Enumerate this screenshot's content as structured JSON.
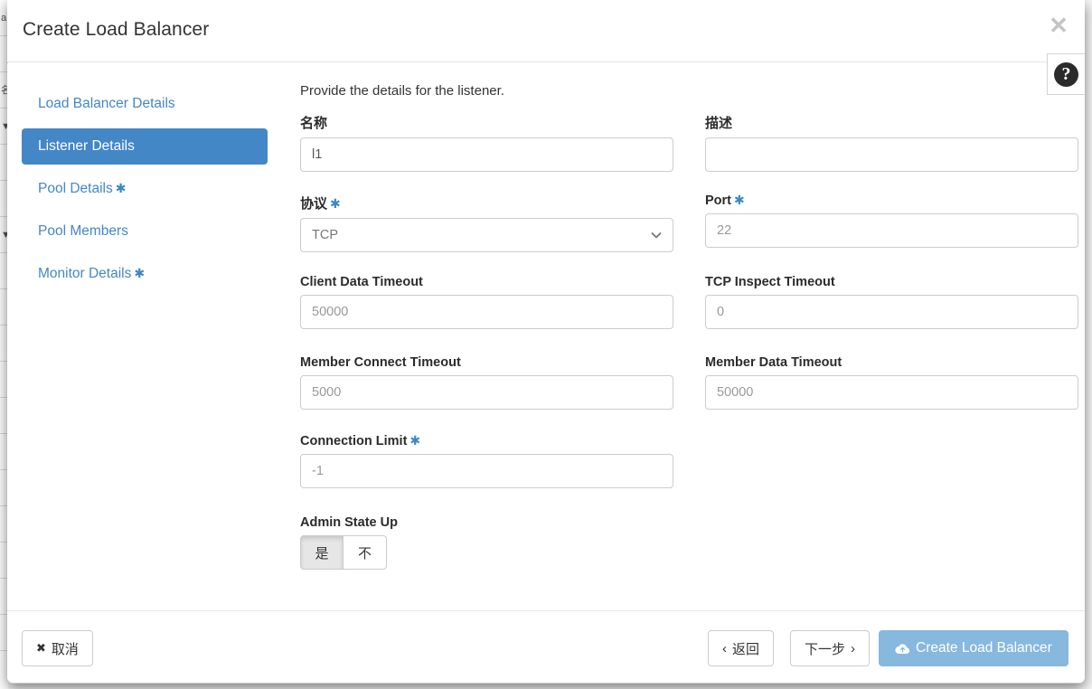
{
  "modal": {
    "title": "Create Load Balancer",
    "close_icon": "close-icon",
    "help_icon": "help-circle-icon",
    "help_glyph": "?"
  },
  "wizard_nav": {
    "items": [
      {
        "label": "Load Balancer Details",
        "required": false,
        "active": false
      },
      {
        "label": "Listener Details",
        "required": false,
        "active": true
      },
      {
        "label": "Pool Details",
        "required": true,
        "active": false
      },
      {
        "label": "Pool Members",
        "required": false,
        "active": false
      },
      {
        "label": "Monitor Details",
        "required": true,
        "active": false
      }
    ],
    "required_marker": "✱"
  },
  "form": {
    "intro": "Provide the details for the listener.",
    "fields": {
      "name": {
        "label": "名称",
        "value": "l1",
        "required": false
      },
      "description": {
        "label": "描述",
        "value": "",
        "required": false
      },
      "protocol": {
        "label": "协议",
        "value": "TCP",
        "required": true
      },
      "port": {
        "label": "Port",
        "value": "22",
        "required": true
      },
      "client_data_timeout": {
        "label": "Client Data Timeout",
        "value": "50000",
        "required": false
      },
      "tcp_inspect_timeout": {
        "label": "TCP Inspect Timeout",
        "value": "0",
        "required": false
      },
      "member_connect_timeout": {
        "label": "Member Connect Timeout",
        "value": "5000",
        "required": false
      },
      "member_data_timeout": {
        "label": "Member Data Timeout",
        "value": "50000",
        "required": false
      },
      "connection_limit": {
        "label": "Connection Limit",
        "value": "-1",
        "required": true
      },
      "admin_state_up": {
        "label": "Admin State Up",
        "options": [
          {
            "label": "是",
            "selected": true
          },
          {
            "label": "不",
            "selected": false
          }
        ]
      }
    },
    "protocol_chevron_icon": "chevron-down-icon"
  },
  "footer": {
    "cancel": {
      "label": "取消",
      "icon": "x-icon"
    },
    "back": {
      "label": "返回",
      "icon": "chevron-left-icon"
    },
    "next": {
      "label": "下一步",
      "icon": "chevron-right-icon"
    },
    "submit": {
      "label": "Create Load Balancer",
      "icon": "cloud-upload-icon"
    }
  },
  "colors": {
    "accent_blue": "#4387c7",
    "required_star": "#3b87c7",
    "submit_bg": "#87b8dd",
    "text": "#333333"
  }
}
